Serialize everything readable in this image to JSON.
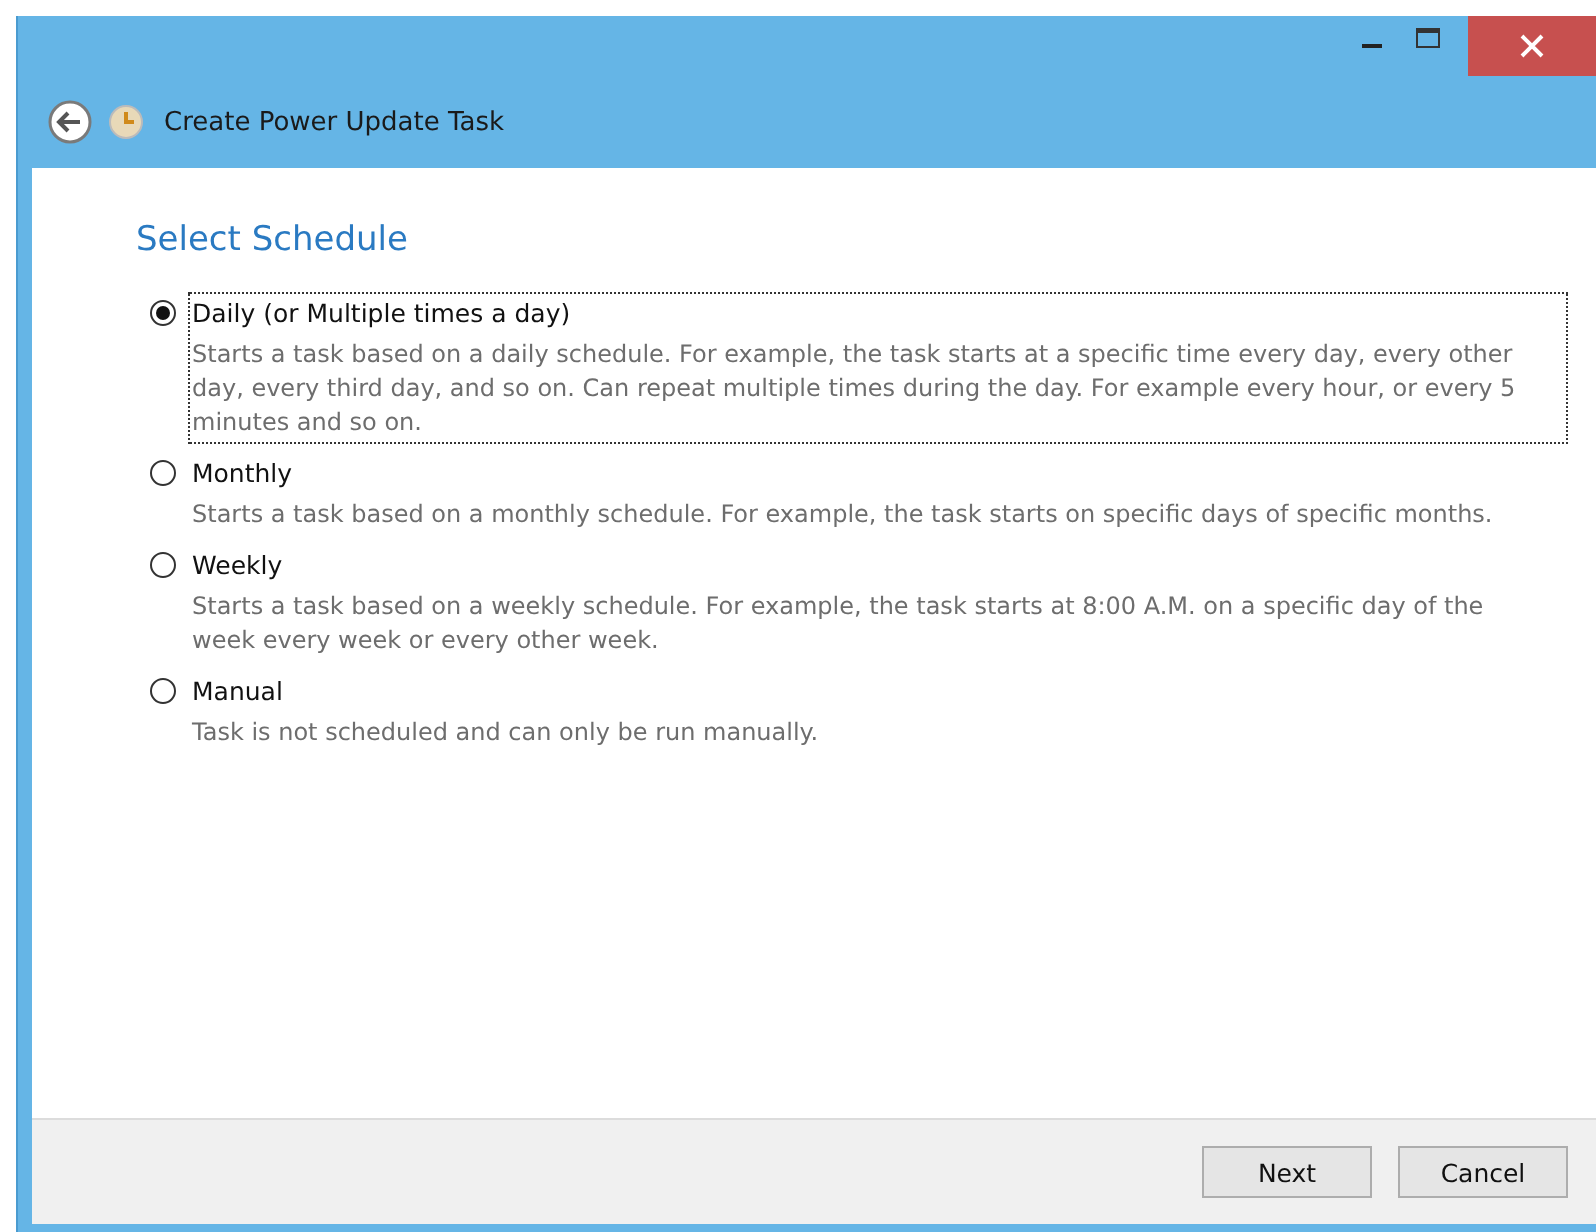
{
  "window": {
    "title": "Create Power Update Task"
  },
  "page": {
    "heading": "Select Schedule"
  },
  "options": [
    {
      "label": "Daily (or Multiple times a day)",
      "description": "Starts a task based on a daily schedule. For example, the task starts at a specific time every day, every other day, every third day, and so on. Can repeat multiple times during the day. For example every hour, or every 5 minutes and so on.",
      "selected": true
    },
    {
      "label": "Monthly",
      "description": "Starts a task based on a monthly schedule. For example, the task starts on specific days of specific months.",
      "selected": false
    },
    {
      "label": "Weekly",
      "description": "Starts a task based on a weekly schedule. For example, the task starts at 8:00 A.M. on a specific day of the week every week or every other week.",
      "selected": false
    },
    {
      "label": "Manual",
      "description": "Task is not scheduled and can only be run manually.",
      "selected": false
    }
  ],
  "buttons": [
    "Next",
    "Cancel"
  ]
}
